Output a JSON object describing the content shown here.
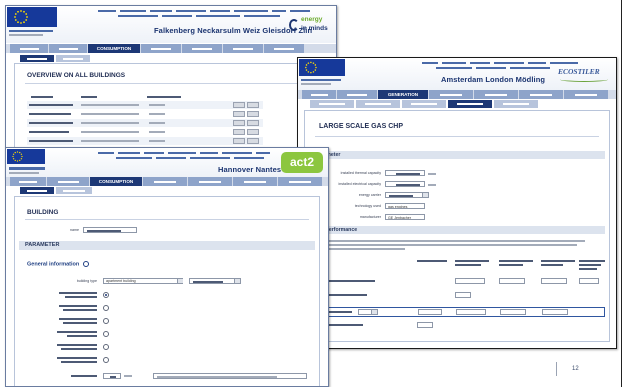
{
  "page": {
    "page_number": "12"
  },
  "colors": {
    "nav_active": "#1d3876",
    "nav_tab": "#8ea4ca",
    "act2_green": "#8cc63f",
    "energy_green": "#6cab2c"
  },
  "w1": {
    "cities": "Falkenberg  Neckarsulm  Weiz Gleisdorf  Zlin",
    "logo_line1": "energy",
    "logo_line2": "in minds",
    "nav_active_tab": "CONSUMPTION",
    "title": "OVERVIEW ON ALL BUILDINGS"
  },
  "w2": {
    "cities": "Amsterdam  London  Mödling",
    "logo": "ECOSTILER",
    "nav_active_tab": "GENERATION",
    "title": "LARGE SCALE GAS CHP",
    "section_parameter": "Parameter",
    "fields": [
      {
        "label": "installed thermal capacity"
      },
      {
        "label": "installed electrical capacity"
      },
      {
        "label": "energy carrier"
      },
      {
        "label": "technology used",
        "value": "gas engines"
      },
      {
        "label": "manufacturer",
        "value": "GE Jenbacher"
      }
    ],
    "section_performance": "chp performance"
  },
  "w3": {
    "cities": "Hannover  Nantes",
    "logo": "act2",
    "nav_active_tab": "CONSUMPTION",
    "title": "BUILDING",
    "name_label": "name",
    "section_parameter": "PARAMETER",
    "general_info": "General information",
    "building_type_label": "building type",
    "building_type_value": "apartment building"
  }
}
